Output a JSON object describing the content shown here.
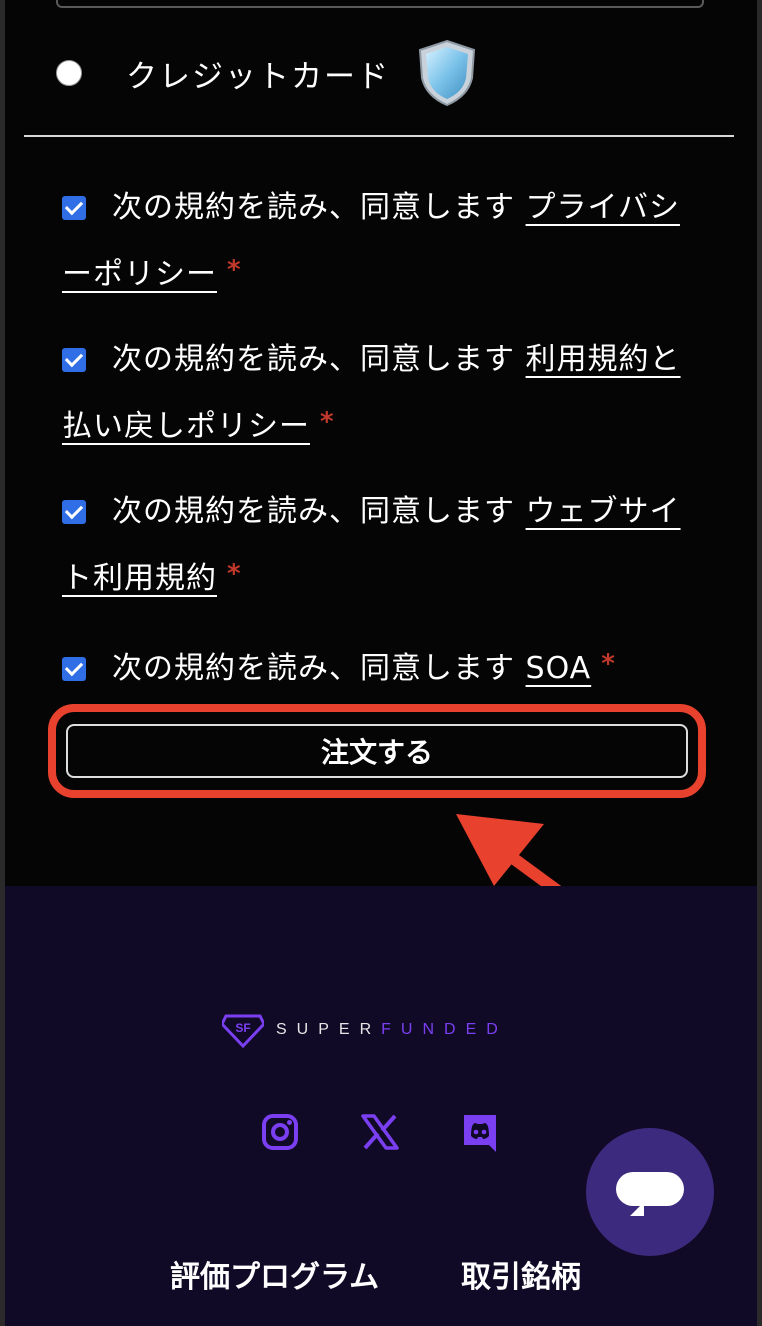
{
  "payment": {
    "credit_card_label": "クレジットカード"
  },
  "agreements": [
    {
      "prefix": "次の規約を読み、同意します",
      "link": "プライバシーポリシー",
      "required": "*"
    },
    {
      "prefix": "次の規約を読み、同意します",
      "link": "利用規約と払い戻しポリシー",
      "required": "*"
    },
    {
      "prefix": "次の規約を読み、同意します",
      "link": "ウェブサイト利用規約",
      "required": "*"
    },
    {
      "prefix": "次の規約を読み、同意します",
      "link": "SOA",
      "required": "*"
    }
  ],
  "order_button_label": "注文する",
  "footer": {
    "logo_text_white": "SUPER",
    "logo_text_purple": "FUNDED",
    "social_icons": [
      "instagram-icon",
      "x-icon",
      "discord-icon"
    ],
    "links": [
      "評価プログラム",
      "取引銘柄"
    ]
  },
  "colors": {
    "accent_purple": "#7b3ff2",
    "checkbox_blue": "#2f6ee5",
    "highlight_red": "#e8412e",
    "footer_bg": "#100a27"
  }
}
